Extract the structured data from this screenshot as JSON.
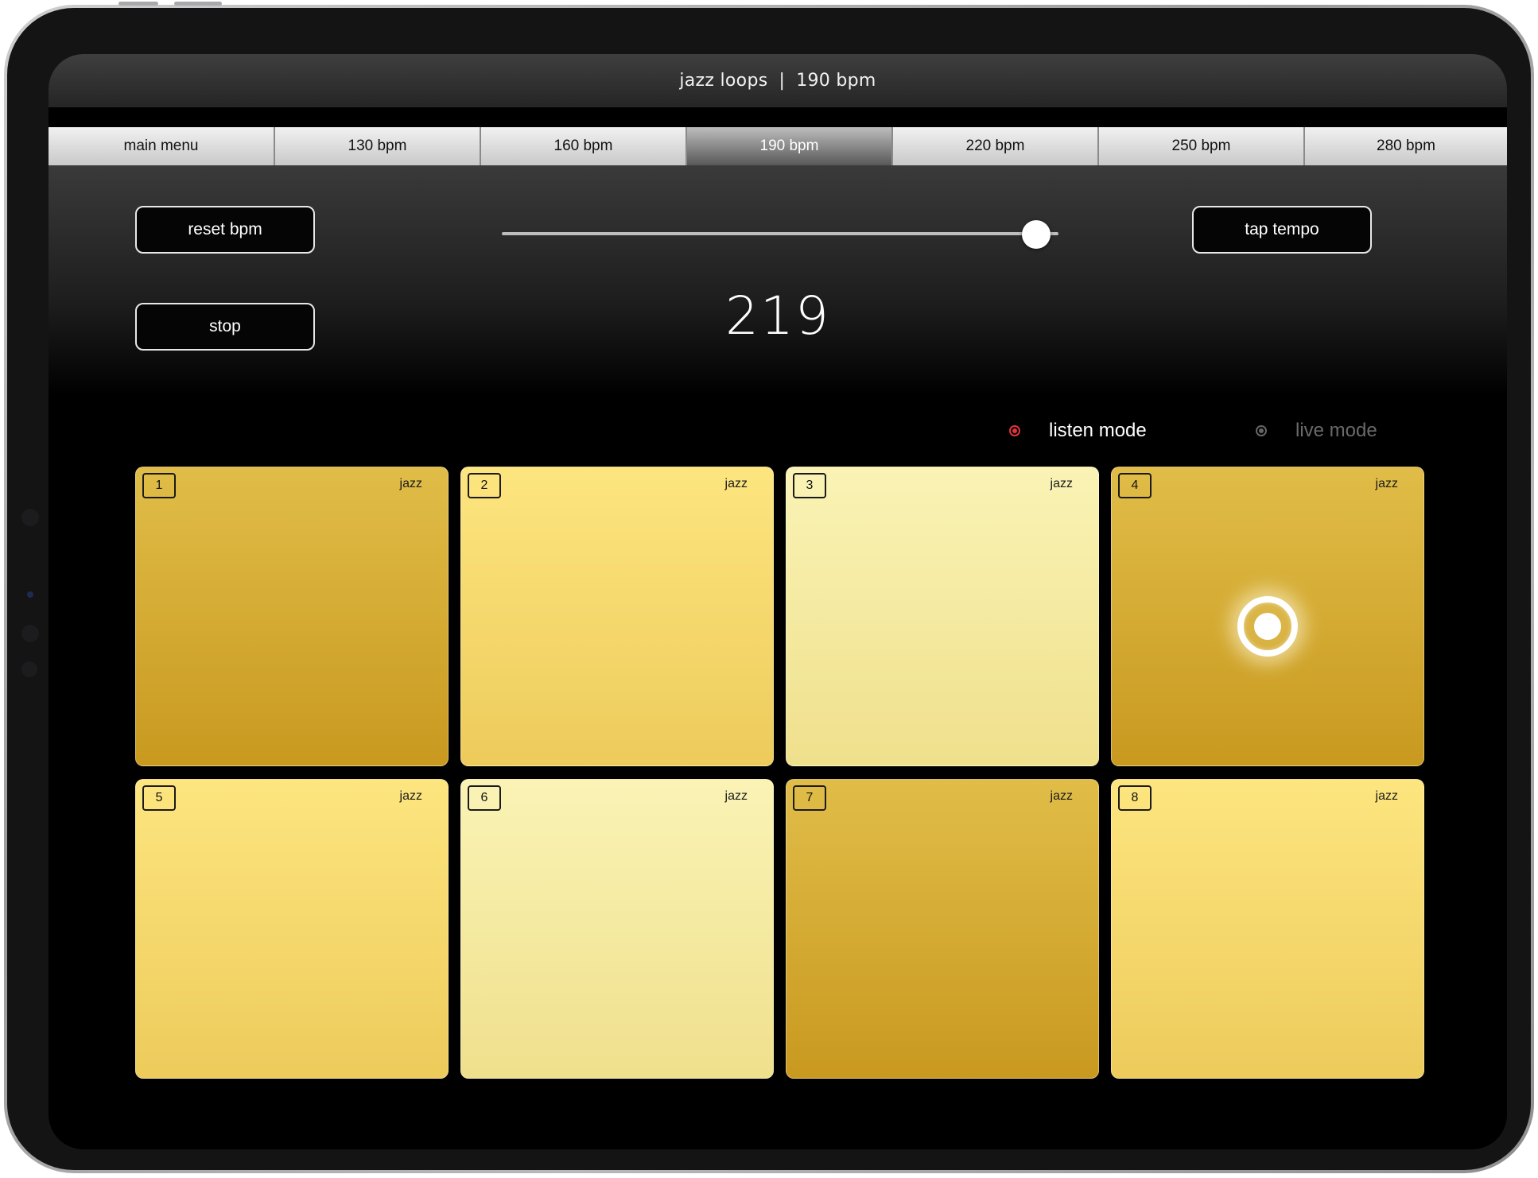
{
  "header": {
    "title": "jazz loops",
    "separator": "|",
    "tempo": "190 bpm"
  },
  "tabs": [
    {
      "label": "main menu",
      "active": false
    },
    {
      "label": "130 bpm",
      "active": false
    },
    {
      "label": "160 bpm",
      "active": false
    },
    {
      "label": "190 bpm",
      "active": true
    },
    {
      "label": "220 bpm",
      "active": false
    },
    {
      "label": "250 bpm",
      "active": false
    },
    {
      "label": "280 bpm",
      "active": false
    }
  ],
  "controls": {
    "reset_label": "reset bpm",
    "tap_label": "tap tempo",
    "stop_label": "stop",
    "bpm_value": "219",
    "slider_fraction": 0.96
  },
  "modes": {
    "listen_label": "listen mode",
    "live_label": "live mode",
    "selected": "listen"
  },
  "pads": [
    {
      "number": "1",
      "genre": "jazz",
      "shade": "dark",
      "playing": false
    },
    {
      "number": "2",
      "genre": "jazz",
      "shade": "mid",
      "playing": false
    },
    {
      "number": "3",
      "genre": "jazz",
      "shade": "light",
      "playing": false
    },
    {
      "number": "4",
      "genre": "jazz",
      "shade": "dark",
      "playing": true
    },
    {
      "number": "5",
      "genre": "jazz",
      "shade": "mid",
      "playing": false
    },
    {
      "number": "6",
      "genre": "jazz",
      "shade": "light",
      "playing": false
    },
    {
      "number": "7",
      "genre": "jazz",
      "shade": "dark",
      "playing": false
    },
    {
      "number": "8",
      "genre": "jazz",
      "shade": "mid",
      "playing": false
    }
  ],
  "colors": {
    "accent_radio": "#e0343c",
    "pad_dark": "#d4aa33",
    "pad_mid": "#f7d96c",
    "pad_light": "#f6eca4"
  }
}
